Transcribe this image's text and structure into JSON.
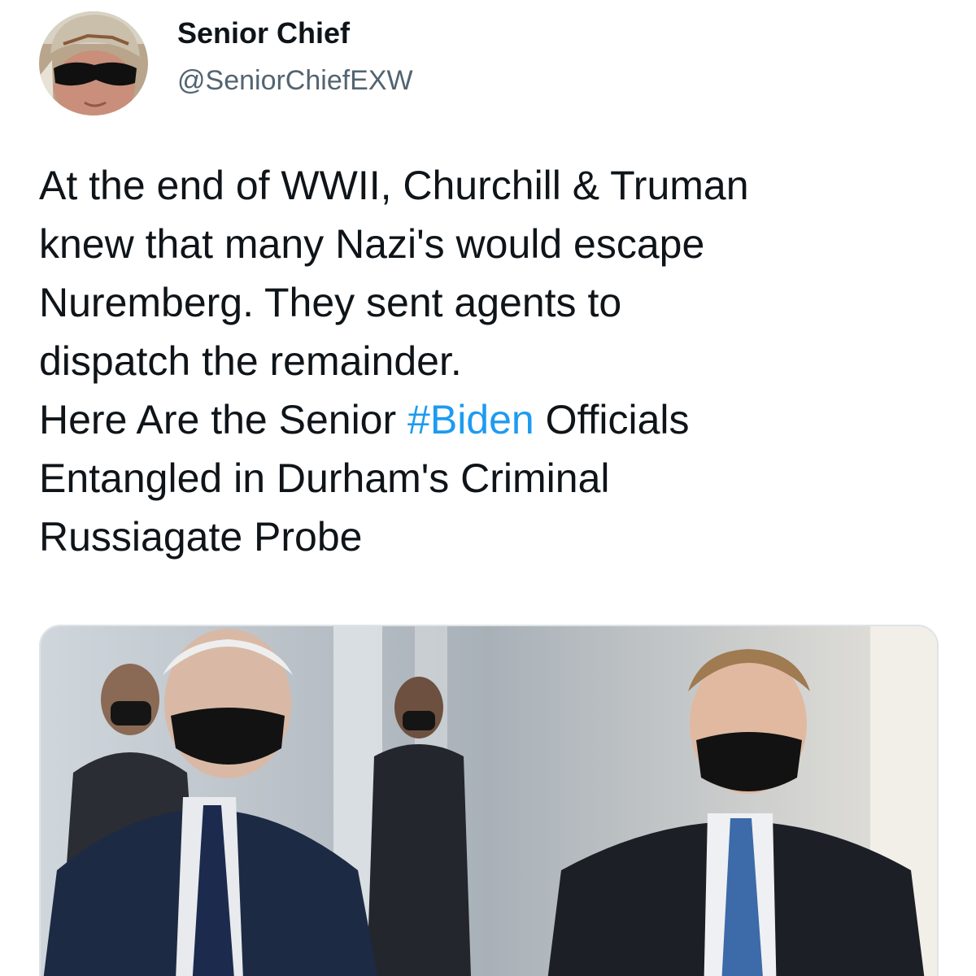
{
  "user": {
    "display_name": "Senior Chief",
    "handle": "@SeniorChiefEXW"
  },
  "tweet": {
    "lines": [
      "At the end of WWII, Churchill & Truman",
      "knew that many Nazi's would escape",
      "Nuremberg. They sent agents to",
      "dispatch the remainder."
    ],
    "line5_before": "Here Are the Senior ",
    "hashtag": "#Biden",
    "line5_after": " Officials",
    "lines_after": [
      "Entangled in Durham's Criminal",
      "Russiagate Probe"
    ]
  },
  "colors": {
    "text": "#0f1419",
    "secondary": "#536471",
    "link": "#1d9bf0",
    "card_border": "#dfe3e6"
  }
}
